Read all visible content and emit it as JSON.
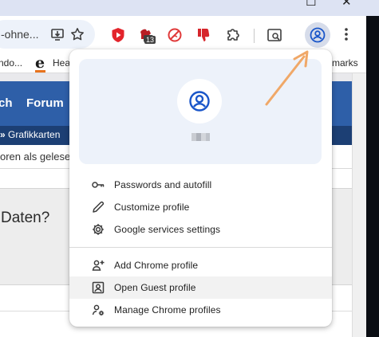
{
  "omnibox": {
    "text": "-ohne..."
  },
  "toolbar": {
    "extension_badge": "13"
  },
  "bookmarks": {
    "item1": "ndo...",
    "item2": "Hea",
    "item3": "marks"
  },
  "page": {
    "nav": {
      "item1": "ch",
      "item2": "Forum"
    },
    "breadcrumb": {
      "sep": "»",
      "current": "Grafikkarten"
    },
    "subline": "oren als gelese",
    "thread_title": "Daten?"
  },
  "profile_menu": {
    "group1": [
      {
        "label": "Passwords and autofill",
        "icon": "key-icon"
      },
      {
        "label": "Customize profile",
        "icon": "pencil-icon"
      },
      {
        "label": "Google services settings",
        "icon": "gear-icon"
      }
    ],
    "group2": [
      {
        "label": "Add Chrome profile",
        "icon": "add-person-icon"
      },
      {
        "label": "Open Guest profile",
        "icon": "guest-profile-icon"
      },
      {
        "label": "Manage Chrome profiles",
        "icon": "manage-profiles-icon"
      }
    ]
  },
  "colors": {
    "accent": "#1a56c9",
    "hero_bg": "#edf2fa",
    "site_nav": "#2e5fa8",
    "arrow": "#f0a868"
  }
}
